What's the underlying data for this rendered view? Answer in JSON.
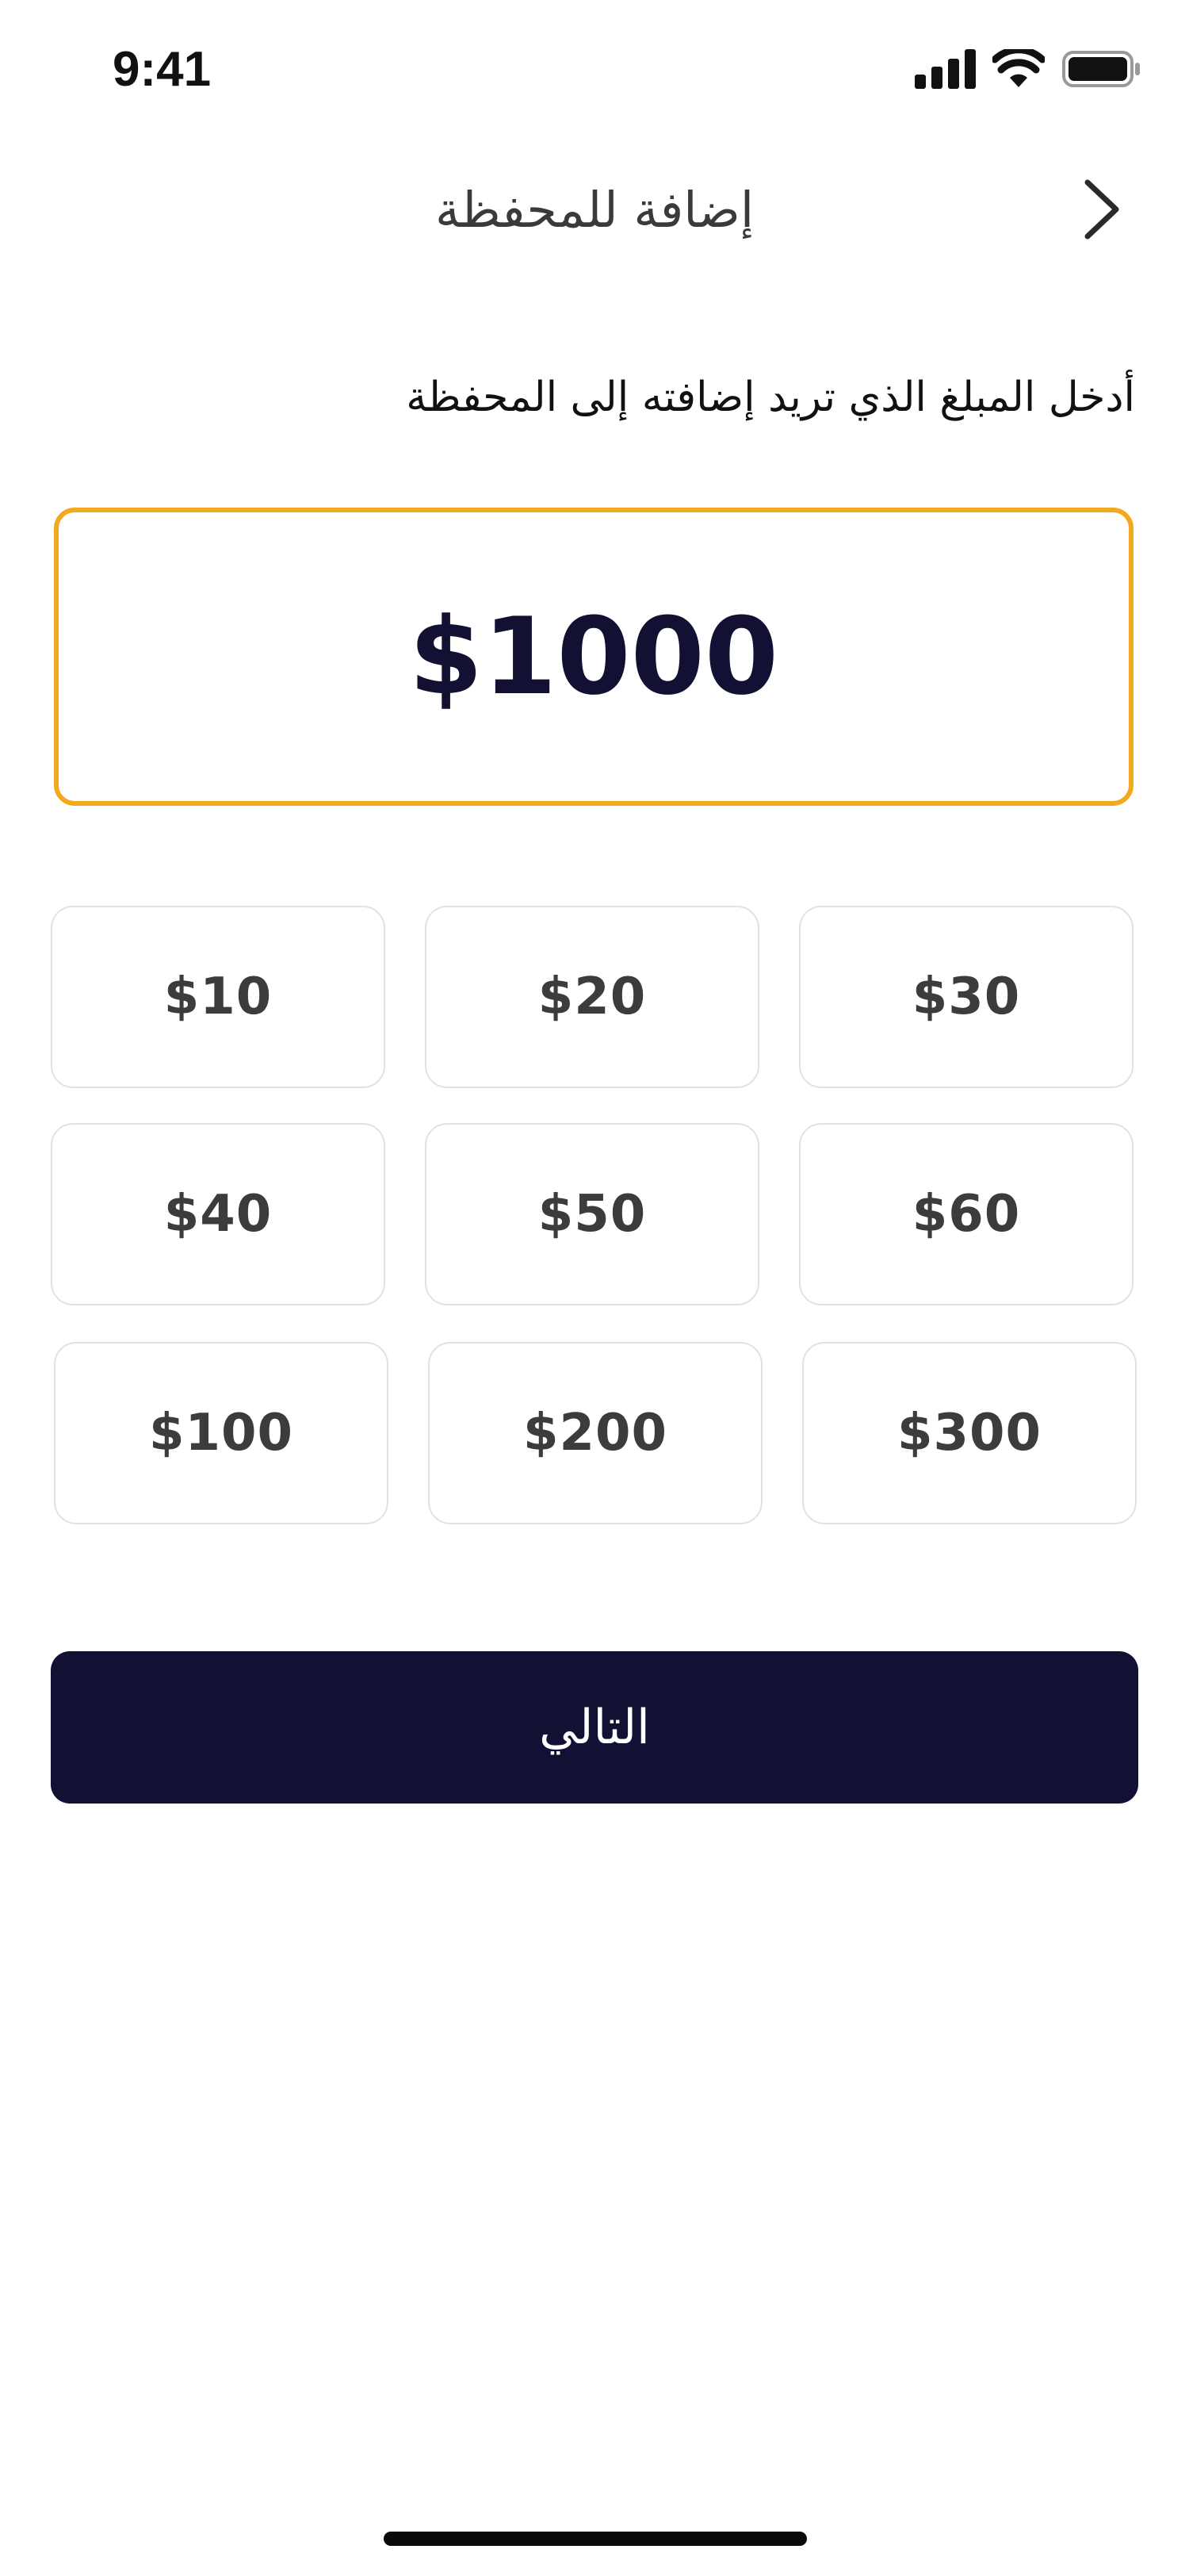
{
  "status_bar": {
    "time": "9:41",
    "icons": [
      "cellular-signal-icon",
      "wifi-icon",
      "battery-icon"
    ]
  },
  "header": {
    "title": "إضافة للمحفظة",
    "back_icon": "chevron-right-icon"
  },
  "instruction": "أدخل المبلغ الذي تريد إضافته إلى المحفظة",
  "amount": {
    "value": "$1000"
  },
  "presets": [
    "$10",
    "$20",
    "$30",
    "$40",
    "$50",
    "$60",
    "$100",
    "$200",
    "$300"
  ],
  "next_button": {
    "label": "التالي"
  },
  "colors": {
    "accent_border": "#F2A91E",
    "primary": "#121133",
    "text": "#111111",
    "preset_text": "#3C3C3C",
    "preset_border": "#E2E2E2"
  }
}
